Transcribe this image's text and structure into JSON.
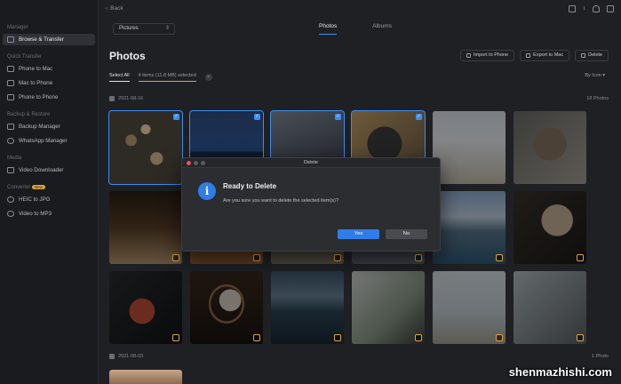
{
  "sidebar": {
    "sections": [
      {
        "title": "Manager",
        "items": [
          {
            "label": "Browse & Transfer",
            "active": true,
            "icon": "folder-icon"
          }
        ]
      },
      {
        "title": "Quick Transfer",
        "items": [
          {
            "label": "Phone to Mac",
            "icon": "phone-to-mac-icon"
          },
          {
            "label": "Mac to Phone",
            "icon": "mac-to-phone-icon"
          },
          {
            "label": "Phone to Phone",
            "icon": "phone-to-phone-icon"
          }
        ]
      },
      {
        "title": "Backup & Restore",
        "items": [
          {
            "label": "Backup Manager",
            "icon": "backup-icon"
          },
          {
            "label": "WhatsApp Manager",
            "icon": "whatsapp-icon"
          }
        ]
      },
      {
        "title": "Media",
        "items": [
          {
            "label": "Video Downloader",
            "icon": "download-icon"
          }
        ]
      },
      {
        "title": "Converter",
        "badge": "New",
        "items": [
          {
            "label": "HEIC to JPG",
            "icon": "image-convert-icon"
          },
          {
            "label": "Video to MP3",
            "icon": "audio-convert-icon"
          }
        ]
      }
    ]
  },
  "topbar": {
    "back_label": "Back",
    "device_number": "1"
  },
  "header": {
    "dropdown_value": "Pictures",
    "tabs": [
      {
        "label": "Photos",
        "active": true
      },
      {
        "label": "Albums",
        "active": false
      }
    ],
    "title": "Photos",
    "actions": {
      "import": "Import to Phone",
      "export": "Export to Mac",
      "delete": "Delete"
    }
  },
  "selection": {
    "select_all": "Select All",
    "info": "4 items (11.8 MB) selected",
    "sort": "By Icon"
  },
  "groups": [
    {
      "date": "2021-08-16",
      "count": "18 Photos"
    },
    {
      "date": "2021-08-03",
      "count": "1 Photo"
    }
  ],
  "dialog": {
    "window_title": "Delete",
    "heading": "Ready to Delete",
    "message": "Are you sure you want to delete the selected item(s)?",
    "yes": "Yes",
    "no": "No",
    "accent": "#2f7de8"
  },
  "watermark": "shenmazhishi.com"
}
